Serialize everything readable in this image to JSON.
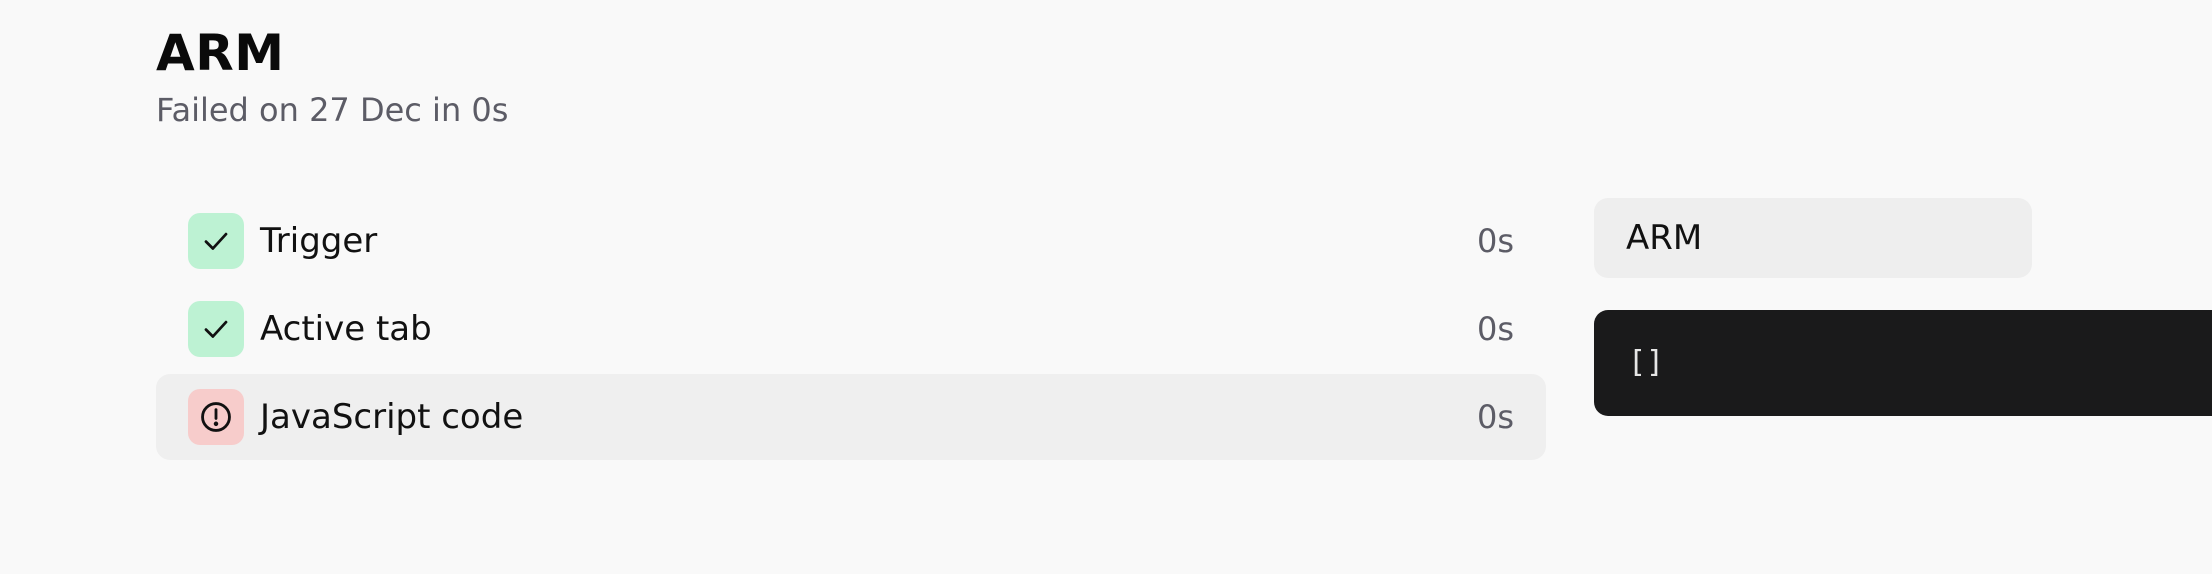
{
  "header": {
    "title": "ARM",
    "subtitle": "Failed on 27 Dec in 0s"
  },
  "steps": [
    {
      "label": "Trigger",
      "duration": "0s",
      "status": "success",
      "icon": "check-icon"
    },
    {
      "label": "Active tab",
      "duration": "0s",
      "status": "success",
      "icon": "check-icon"
    },
    {
      "label": "JavaScript code",
      "duration": "0s",
      "status": "error",
      "icon": "alert-circle-icon",
      "selected": true
    }
  ],
  "detail": {
    "header_label": "ARM",
    "output": "[]"
  },
  "colors": {
    "background": "#f9f9f9",
    "success_bg": "#bdf2d3",
    "error_bg": "#f7cccb",
    "selected_row_bg": "#efefef",
    "output_bg": "#1a1a1b"
  }
}
